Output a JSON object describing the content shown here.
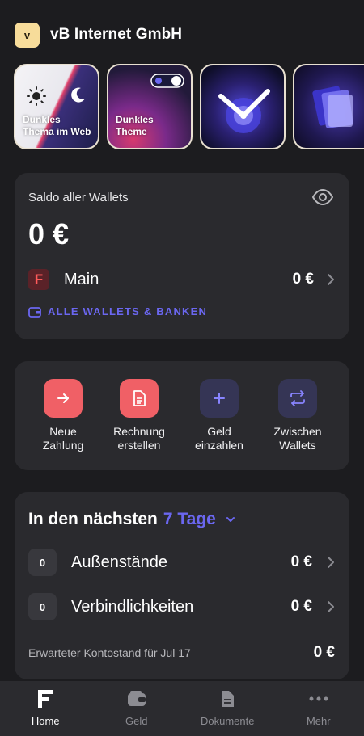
{
  "header": {
    "avatar_letter": "v",
    "company_name": "vB Internet GmbH"
  },
  "stories": [
    {
      "label_line1": "Dunkles",
      "label_line2": "Thema im Web"
    },
    {
      "label_line1": "Dunkles",
      "label_line2": "Theme"
    },
    {
      "label_line1": "",
      "label_line2": ""
    },
    {
      "label_line1": "",
      "label_line2": ""
    }
  ],
  "wallets_card": {
    "title": "Saldo aller Wallets",
    "balance": "0 €",
    "main_wallet": {
      "name": "Main",
      "amount": "0 €"
    },
    "all_wallets_link": "ALLE WALLETS & BANKEN"
  },
  "actions": [
    {
      "line1": "Neue",
      "line2": "Zahlung",
      "icon": "arrow-right-icon"
    },
    {
      "line1": "Rechnung",
      "line2": "erstellen",
      "icon": "invoice-icon"
    },
    {
      "line1": "Geld",
      "line2": "einzahlen",
      "icon": "plus-icon"
    },
    {
      "line1": "Zwischen",
      "line2": "Wallets",
      "icon": "transfer-icon"
    }
  ],
  "upcoming": {
    "title_prefix": "In den nächsten",
    "period": "7 Tage",
    "rows": [
      {
        "count": "0",
        "name": "Außenstände",
        "amount": "0 €"
      },
      {
        "count": "0",
        "name": "Verbindlichkeiten",
        "amount": "0 €"
      }
    ],
    "expected_label": "Erwarteter Kontostand für Jul 17",
    "expected_amount": "0 €"
  },
  "bottom_nav": {
    "items": [
      {
        "label": "Home",
        "active": true
      },
      {
        "label": "Geld",
        "active": false
      },
      {
        "label": "Dokumente",
        "active": false
      },
      {
        "label": "Mehr",
        "active": false
      }
    ]
  },
  "colors": {
    "accent": "#6b67f0",
    "red_action": "#f06066",
    "card_bg": "#2a2a2e",
    "page_bg": "#1c1c1f"
  }
}
